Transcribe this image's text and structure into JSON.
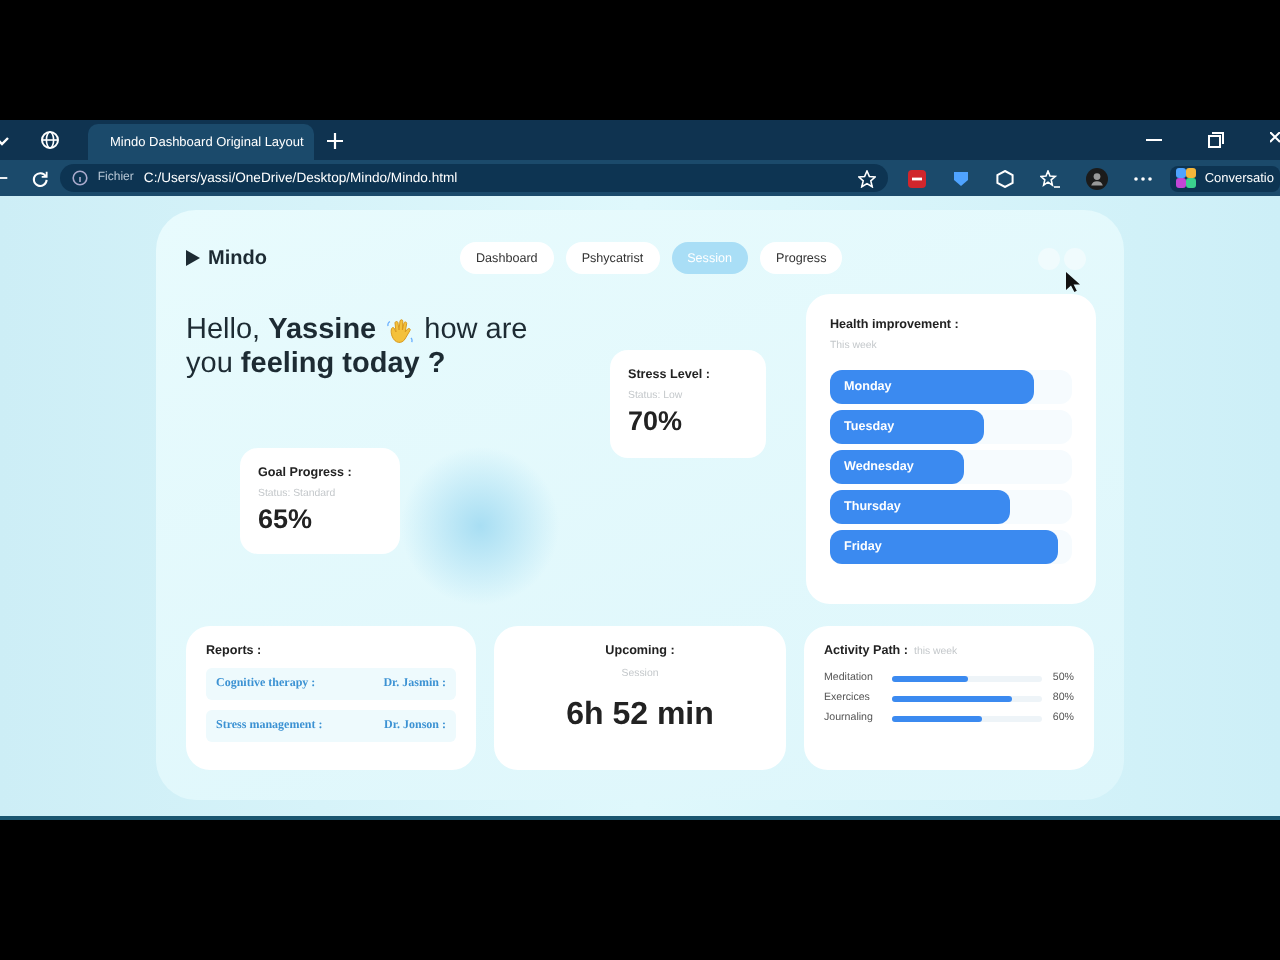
{
  "browser": {
    "tabs": [
      {
        "title": "Mindo Dashboard Original Layout",
        "selected": true
      }
    ],
    "address": {
      "scheme": "Fichier",
      "url": "C:/Users/yassi/OneDrive/Desktop/Mindo/Mindo.html"
    },
    "side_button": "Conversatio"
  },
  "app": {
    "logo": "Mindo",
    "nav": [
      {
        "label": "Dashboard",
        "selected": false
      },
      {
        "label": "Pshycatrist",
        "selected": false
      },
      {
        "label": "Session",
        "selected": true
      },
      {
        "label": "Progress",
        "selected": false
      }
    ],
    "greeting": {
      "start": "Hello, **Yassine**",
      "middle": "how are",
      "end": "you **feeling today ?**"
    },
    "stress": {
      "title": "Stress Level :",
      "status": "Status: Low",
      "value": "70%"
    },
    "goal": {
      "title": "Goal Progress :",
      "status": "Status: Standard",
      "value": "65%"
    },
    "health": {
      "title": "Health improvement :",
      "subtitle": "This week",
      "days": [
        {
          "label": "Monday",
          "level": 0.84
        },
        {
          "label": "Tuesday",
          "level": 0.64
        },
        {
          "label": "Wednesday",
          "level": 0.55
        },
        {
          "label": "Thursday",
          "level": 0.74
        },
        {
          "label": "Friday",
          "level": 0.94
        }
      ]
    },
    "reports": {
      "title": "Reports :",
      "items": [
        {
          "topic": "Cognitive therapy :",
          "doctor": "Dr. Jasmin :"
        },
        {
          "topic": "Stress management :",
          "doctor": "Dr. Jonson :"
        }
      ]
    },
    "upcoming": {
      "title": "Upcoming :",
      "subtitle": "Session",
      "value": "6h 52 min"
    },
    "activity": {
      "title": "Activity Path :",
      "subtitle": "this week",
      "items": [
        {
          "label": "Meditation",
          "level": 0.5,
          "reading": "50%"
        },
        {
          "label": "Exercices",
          "level": 0.8,
          "reading": "80%"
        },
        {
          "label": "Journaling",
          "level": 0.6,
          "reading": "60%"
        }
      ]
    }
  }
}
